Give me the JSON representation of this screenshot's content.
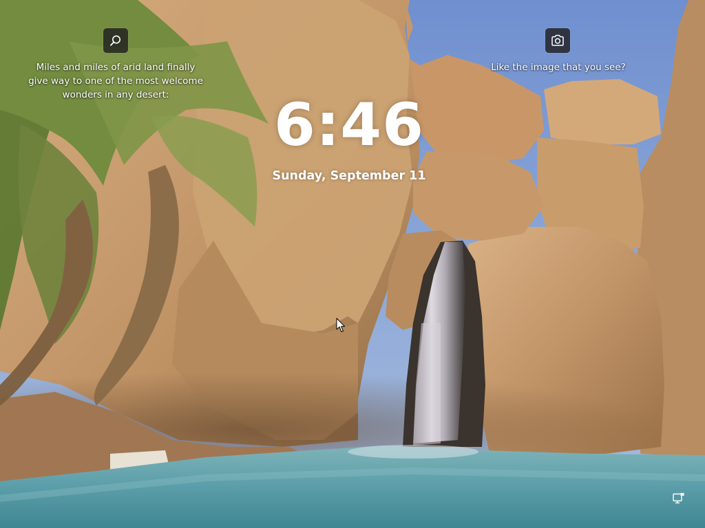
{
  "lock_screen": {
    "time": "6:46",
    "date": "Sunday, September 11"
  },
  "spotlight": {
    "search_tip": "Miles and miles of arid land finally\ngive way to one of the most welcome\nwonders in any desert:",
    "camera_tip": "Like the image that you see?",
    "search_icon": "search-icon",
    "camera_icon": "camera-icon"
  },
  "status": {
    "network_icon": "network-wired-icon"
  },
  "colors": {
    "sky": "#7f9bd0",
    "rock": "#c69a66",
    "water": "#6aa8b4",
    "palm": "#6d8a3e",
    "button_bg": "#202020"
  }
}
